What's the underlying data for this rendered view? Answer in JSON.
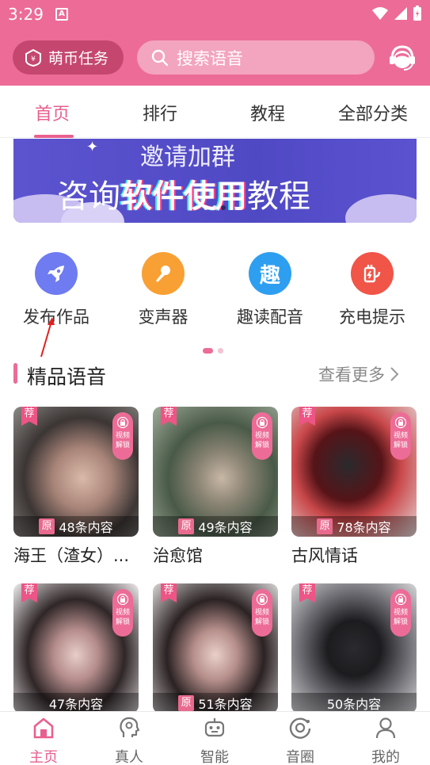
{
  "status_bar": {
    "time": "3:29",
    "notice_glyph": "A"
  },
  "header": {
    "task_button_label": "萌币任务",
    "search_placeholder": "搜索语音",
    "icons": [
      "coin-badge-icon",
      "search-icon",
      "customer-service-icon"
    ]
  },
  "tabs": [
    {
      "label": "首页",
      "active": true
    },
    {
      "label": "排行",
      "active": false
    },
    {
      "label": "教程",
      "active": false
    },
    {
      "label": "全部分类",
      "active": false
    }
  ],
  "banner": {
    "line1": "邀请加群",
    "line2_prefix": "咨询",
    "line2_highlight": "软件使用",
    "line2_suffix": "教程"
  },
  "functions": [
    {
      "label": "发布作品",
      "icon": "rocket-icon",
      "color": "#6f7bf0"
    },
    {
      "label": "变声器",
      "icon": "microphone-icon",
      "color": "#f8a033"
    },
    {
      "label": "趣读配音",
      "icon_text": "趣",
      "color": "#2e9ff0"
    },
    {
      "label": "充电提示",
      "icon": "charging-icon",
      "color": "#f05548"
    }
  ],
  "section": {
    "title": "精品语音",
    "more": "查看更多"
  },
  "cards": [
    {
      "title": "海王（渣女）...",
      "count": "48条内容",
      "rec": "荐",
      "yuan": "原",
      "lock": "视频\n解锁"
    },
    {
      "title": "治愈馆",
      "count": "49条内容",
      "rec": "荐",
      "yuan": "原",
      "lock": "视频\n解锁"
    },
    {
      "title": "古风情话",
      "count": "78条内容",
      "rec": "荐",
      "yuan": "原",
      "lock": "视频\n解锁"
    },
    {
      "title": "",
      "count": "47条内容",
      "rec": "荐",
      "yuan": "",
      "lock": "视频\n解锁"
    },
    {
      "title": "",
      "count": "51条内容",
      "rec": "荐",
      "yuan": "原",
      "lock": "视频\n解锁"
    },
    {
      "title": "",
      "count": "50条内容",
      "rec": "荐",
      "yuan": "",
      "lock": "视频\n解锁"
    }
  ],
  "bottom_nav": [
    {
      "label": "主页",
      "icon": "home-icon",
      "active": true
    },
    {
      "label": "真人",
      "icon": "person-head-icon",
      "active": false
    },
    {
      "label": "智能",
      "icon": "robot-icon",
      "active": false
    },
    {
      "label": "音圈",
      "icon": "sound-circle-icon",
      "active": false
    },
    {
      "label": "我的",
      "icon": "profile-icon",
      "active": false
    }
  ],
  "colors": {
    "brand_pink": "#ec6c97",
    "tab_active": "#e8608f",
    "banner_purple": "#5049c4"
  }
}
